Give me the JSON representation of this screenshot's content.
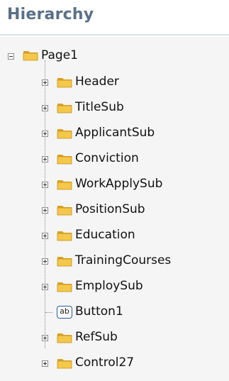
{
  "panel": {
    "title": "Hierarchy"
  },
  "tree": {
    "root": {
      "label": "Page1",
      "icon": "folder-icon",
      "expanded": true
    },
    "children": [
      {
        "label": "Header",
        "icon": "folder-icon",
        "expandable": true
      },
      {
        "label": "TitleSub",
        "icon": "folder-icon",
        "expandable": true
      },
      {
        "label": "ApplicantSub",
        "icon": "folder-icon",
        "expandable": true
      },
      {
        "label": "Conviction",
        "icon": "folder-icon",
        "expandable": true
      },
      {
        "label": "WorkApplySub",
        "icon": "folder-icon",
        "expandable": true
      },
      {
        "label": "PositionSub",
        "icon": "folder-icon",
        "expandable": true
      },
      {
        "label": "Education",
        "icon": "folder-icon",
        "expandable": true
      },
      {
        "label": "TrainingCourses",
        "icon": "folder-icon",
        "expandable": true
      },
      {
        "label": "EmploySub",
        "icon": "folder-icon",
        "expandable": true
      },
      {
        "label": "Button1",
        "icon": "textbox-icon",
        "icon_text": "ab",
        "expandable": false
      },
      {
        "label": "RefSub",
        "icon": "folder-icon",
        "expandable": true
      },
      {
        "label": "Control27",
        "icon": "folder-icon",
        "expandable": true
      }
    ]
  },
  "colors": {
    "title": "#5a6f87",
    "folder_fill": "#f5c84a",
    "folder_dark": "#d9a126",
    "icon_border": "#2a5a9e"
  }
}
